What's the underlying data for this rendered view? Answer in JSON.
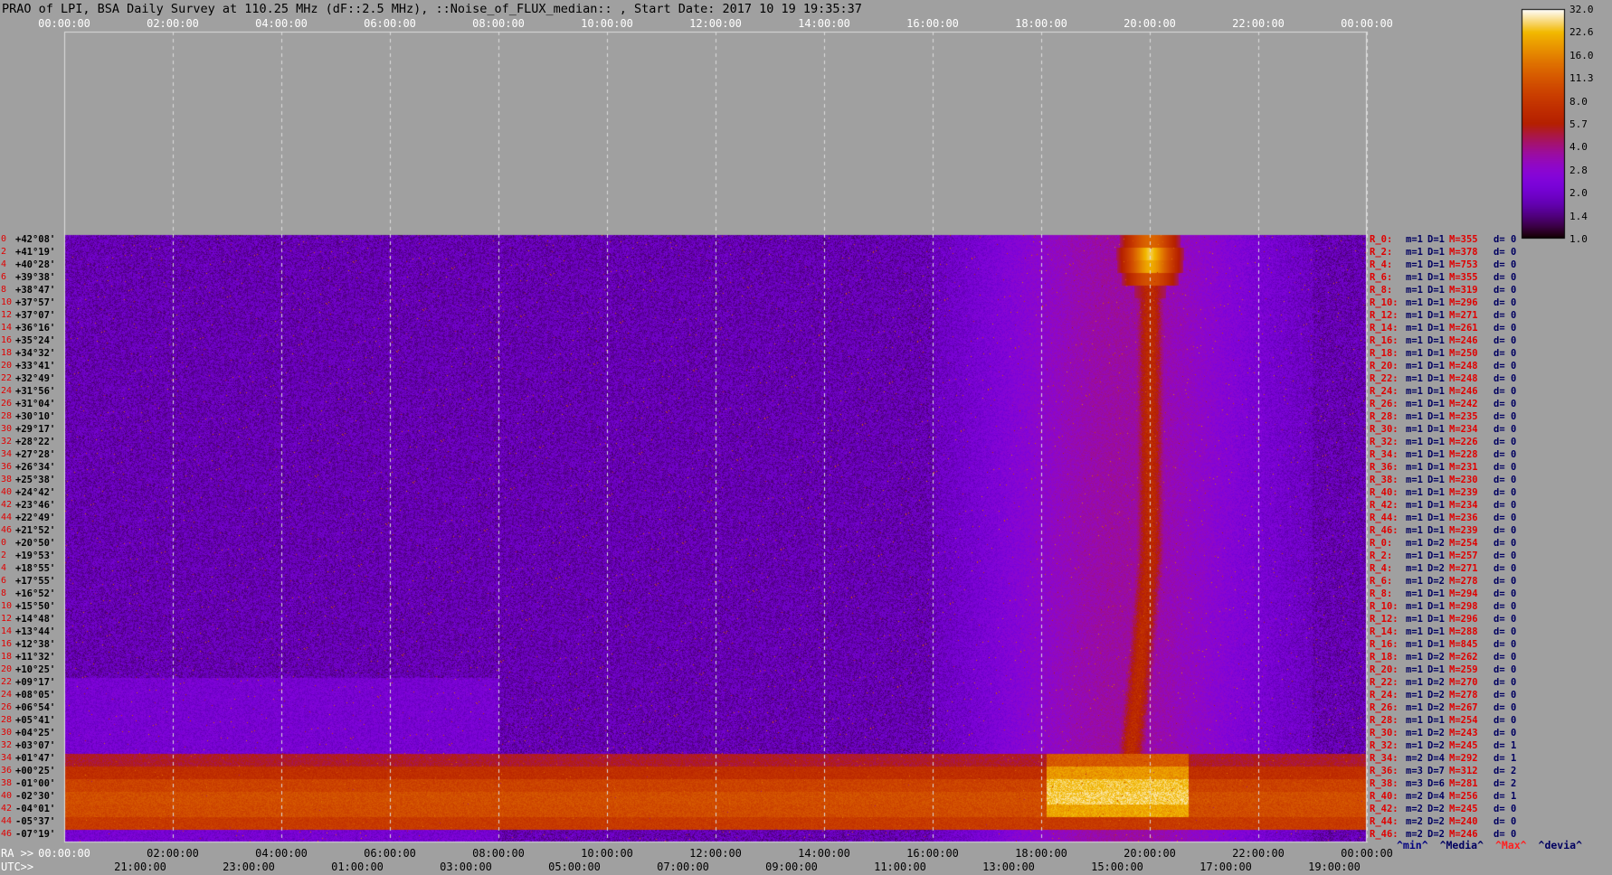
{
  "title": "PRAO of LPI, BSA Daily Survey at 110.25 MHz (dF::2.5 MHz), ::Noise_of_FLUX_median:: , Start Date: 2017 10 19 19:35:37",
  "colors": {
    "background": "#a0a0a0",
    "label_red": "#e00000",
    "label_navy": "#000060",
    "min_color": "#000080",
    "max_color": "#ff2020"
  },
  "chart_data": {
    "type": "heatmap",
    "title": "PRAO of LPI, BSA Daily Survey at 110.25 MHz (dF::2.5 MHz), ::Noise_of_FLUX_median:: , Start Date: 2017 10 19 19:35:37",
    "colormap": "gnuplot-like (black-purple-red-orange-yellow-white)",
    "colorbar": {
      "ticks": [
        "32.0",
        "22.6",
        "16.0",
        "11.3",
        "8.0",
        "5.7",
        "4.0",
        "2.8",
        "2.0",
        "1.4",
        "1.0"
      ],
      "scale": "log",
      "range": [
        1.0,
        32.0
      ]
    },
    "top_time_ticks": [
      "00:00:00",
      "02:00:00",
      "04:00:00",
      "06:00:00",
      "08:00:00",
      "10:00:00",
      "12:00:00",
      "14:00:00",
      "16:00:00",
      "18:00:00",
      "20:00:00",
      "22:00:00",
      "00:00:00"
    ],
    "ra_axis": {
      "label": "RA >>",
      "ticks": [
        "00:00:00",
        "02:00:00",
        "04:00:00",
        "06:00:00",
        "08:00:00",
        "10:00:00",
        "12:00:00",
        "14:00:00",
        "16:00:00",
        "18:00:00",
        "20:00:00",
        "22:00:00",
        "00:00:00"
      ]
    },
    "utc_axis": {
      "label": "UTC>>",
      "ticks": [
        "21:00:00",
        "23:00:00",
        "01:00:00",
        "03:00:00",
        "05:00:00",
        "07:00:00",
        "09:00:00",
        "11:00:00",
        "13:00:00",
        "15:00:00",
        "17:00:00",
        "19:00:00"
      ]
    },
    "row_indices": [
      "0",
      "2",
      "4",
      "6",
      "8",
      "10",
      "12",
      "14",
      "16",
      "18",
      "20",
      "22",
      "24",
      "26",
      "28",
      "30",
      "32",
      "34",
      "36",
      "38",
      "40",
      "42",
      "44",
      "46",
      "0",
      "2",
      "4",
      "6",
      "8",
      "10",
      "12",
      "14",
      "16",
      "18",
      "20",
      "22",
      "24",
      "26",
      "28",
      "30",
      "32",
      "34",
      "36",
      "38",
      "40",
      "42",
      "44",
      "46"
    ],
    "declinations": [
      "+42°08'",
      "+41°19'",
      "+40°28'",
      "+39°38'",
      "+38°47'",
      "+37°57'",
      "+37°07'",
      "+36°16'",
      "+35°24'",
      "+34°32'",
      "+33°41'",
      "+32°49'",
      "+31°56'",
      "+31°04'",
      "+30°10'",
      "+29°17'",
      "+28°22'",
      "+27°28'",
      "+26°34'",
      "+25°38'",
      "+24°42'",
      "+23°46'",
      "+22°49'",
      "+21°52'",
      "+20°50'",
      "+19°53'",
      "+18°55'",
      "+17°55'",
      "+16°52'",
      "+15°50'",
      "+14°48'",
      "+13°44'",
      "+12°38'",
      "+11°32'",
      "+10°25'",
      "+09°17'",
      "+08°05'",
      "+06°54'",
      "+05°41'",
      "+04°25'",
      "+03°07'",
      "+01°47'",
      "+00°25'",
      "-01°00'",
      "-02°30'",
      "-04°01'",
      "-05°37'",
      "-07°19'"
    ],
    "row_stats": [
      [
        "R_0:",
        "m=1",
        "D=1",
        "M=355",
        "d= 0"
      ],
      [
        "R_2:",
        "m=1",
        "D=1",
        "M=378",
        "d= 0"
      ],
      [
        "R_4:",
        "m=1",
        "D=1",
        "M=753",
        "d= 0"
      ],
      [
        "R_6:",
        "m=1",
        "D=1",
        "M=355",
        "d= 0"
      ],
      [
        "R_8:",
        "m=1",
        "D=1",
        "M=319",
        "d= 0"
      ],
      [
        "R_10:",
        "m=1",
        "D=1",
        "M=296",
        "d= 0"
      ],
      [
        "R_12:",
        "m=1",
        "D=1",
        "M=271",
        "d= 0"
      ],
      [
        "R_14:",
        "m=1",
        "D=1",
        "M=261",
        "d= 0"
      ],
      [
        "R_16:",
        "m=1",
        "D=1",
        "M=246",
        "d= 0"
      ],
      [
        "R_18:",
        "m=1",
        "D=1",
        "M=250",
        "d= 0"
      ],
      [
        "R_20:",
        "m=1",
        "D=1",
        "M=248",
        "d= 0"
      ],
      [
        "R_22:",
        "m=1",
        "D=1",
        "M=248",
        "d= 0"
      ],
      [
        "R_24:",
        "m=1",
        "D=1",
        "M=246",
        "d= 0"
      ],
      [
        "R_26:",
        "m=1",
        "D=1",
        "M=242",
        "d= 0"
      ],
      [
        "R_28:",
        "m=1",
        "D=1",
        "M=235",
        "d= 0"
      ],
      [
        "R_30:",
        "m=1",
        "D=1",
        "M=234",
        "d= 0"
      ],
      [
        "R_32:",
        "m=1",
        "D=1",
        "M=226",
        "d= 0"
      ],
      [
        "R_34:",
        "m=1",
        "D=1",
        "M=228",
        "d= 0"
      ],
      [
        "R_36:",
        "m=1",
        "D=1",
        "M=231",
        "d= 0"
      ],
      [
        "R_38:",
        "m=1",
        "D=1",
        "M=230",
        "d= 0"
      ],
      [
        "R_40:",
        "m=1",
        "D=1",
        "M=239",
        "d= 0"
      ],
      [
        "R_42:",
        "m=1",
        "D=1",
        "M=234",
        "d= 0"
      ],
      [
        "R_44:",
        "m=1",
        "D=1",
        "M=236",
        "d= 0"
      ],
      [
        "R_46:",
        "m=1",
        "D=1",
        "M=239",
        "d= 0"
      ],
      [
        "R_0:",
        "m=1",
        "D=2",
        "M=254",
        "d= 0"
      ],
      [
        "R_2:",
        "m=1",
        "D=1",
        "M=257",
        "d= 0"
      ],
      [
        "R_4:",
        "m=1",
        "D=2",
        "M=271",
        "d= 0"
      ],
      [
        "R_6:",
        "m=1",
        "D=2",
        "M=278",
        "d= 0"
      ],
      [
        "R_8:",
        "m=1",
        "D=1",
        "M=294",
        "d= 0"
      ],
      [
        "R_10:",
        "m=1",
        "D=1",
        "M=298",
        "d= 0"
      ],
      [
        "R_12:",
        "m=1",
        "D=1",
        "M=296",
        "d= 0"
      ],
      [
        "R_14:",
        "m=1",
        "D=1",
        "M=288",
        "d= 0"
      ],
      [
        "R_16:",
        "m=1",
        "D=1",
        "M=845",
        "d= 0"
      ],
      [
        "R_18:",
        "m=1",
        "D=2",
        "M=262",
        "d= 0"
      ],
      [
        "R_20:",
        "m=1",
        "D=1",
        "M=259",
        "d= 0"
      ],
      [
        "R_22:",
        "m=1",
        "D=2",
        "M=270",
        "d= 0"
      ],
      [
        "R_24:",
        "m=1",
        "D=2",
        "M=278",
        "d= 0"
      ],
      [
        "R_26:",
        "m=1",
        "D=2",
        "M=267",
        "d= 0"
      ],
      [
        "R_28:",
        "m=1",
        "D=1",
        "M=254",
        "d= 0"
      ],
      [
        "R_30:",
        "m=1",
        "D=2",
        "M=243",
        "d= 0"
      ],
      [
        "R_32:",
        "m=1",
        "D=2",
        "M=245",
        "d= 1"
      ],
      [
        "R_34:",
        "m=2",
        "D=4",
        "M=292",
        "d= 1"
      ],
      [
        "R_36:",
        "m=3",
        "D=7",
        "M=312",
        "d= 2"
      ],
      [
        "R_38:",
        "m=3",
        "D=6",
        "M=281",
        "d= 2"
      ],
      [
        "R_40:",
        "m=2",
        "D=4",
        "M=256",
        "d= 1"
      ],
      [
        "R_42:",
        "m=2",
        "D=2",
        "M=245",
        "d= 0"
      ],
      [
        "R_44:",
        "m=2",
        "D=2",
        "M=240",
        "d= 0"
      ],
      [
        "R_46:",
        "m=2",
        "D=2",
        "M=246",
        "d= 0"
      ]
    ],
    "stat_legend": {
      "min": "^min^",
      "median": "^Media^",
      "max": "^Max^",
      "devia": "^devia^"
    },
    "features": [
      {
        "name": "galactic-plane band",
        "ra_hours": [
          0,
          24
        ],
        "dec_deg": [
          -7,
          3
        ],
        "level": 12
      },
      {
        "name": "bright source band",
        "ra_hours": [
          18.1,
          20.7
        ],
        "dec_deg": [
          -5,
          3
        ],
        "level": 30
      },
      {
        "name": "bright point source",
        "ra_hours": 20.0,
        "dec_deg": 41,
        "level": 32
      },
      {
        "name": "galactic plane ridge",
        "ra_hours": [
          19.3,
          20.5
        ],
        "dec_deg": [
          -5,
          42
        ],
        "level": 8
      }
    ]
  }
}
